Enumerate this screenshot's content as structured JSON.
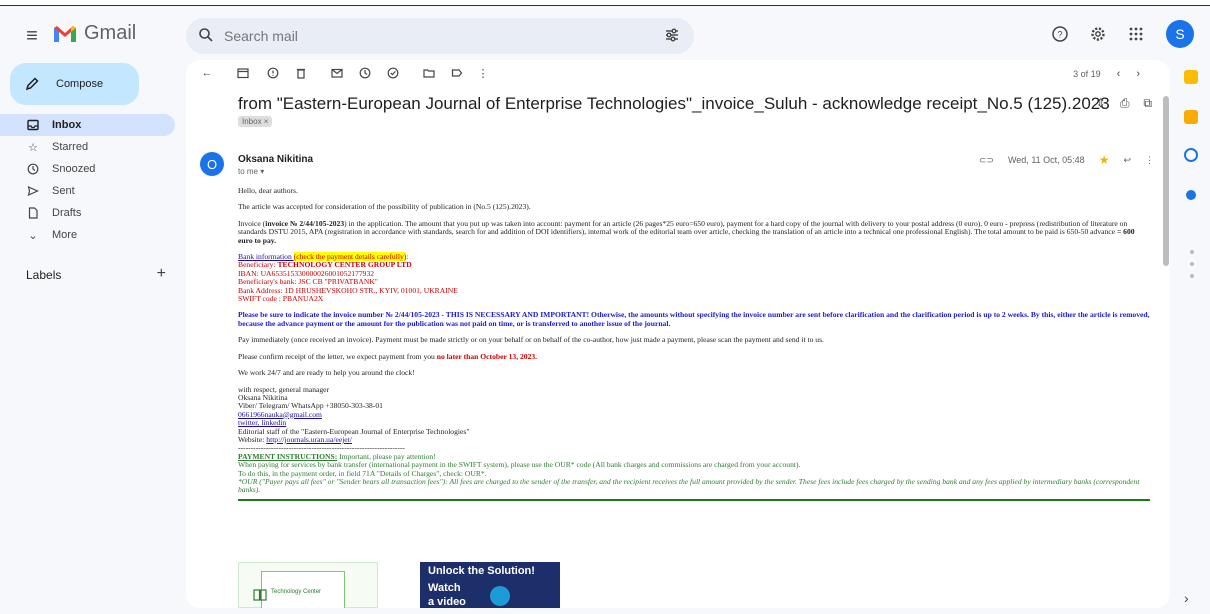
{
  "app": {
    "name": "Gmail"
  },
  "search": {
    "placeholder": "Search mail"
  },
  "header_icons": [
    "help-icon",
    "settings-icon",
    "apps-icon"
  ],
  "account_initial": "S",
  "sidebar": {
    "compose_label": "Compose",
    "items": [
      {
        "label": "Inbox",
        "icon": "inbox-icon",
        "active": true
      },
      {
        "label": "Starred",
        "icon": "star-icon"
      },
      {
        "label": "Snoozed",
        "icon": "clock-icon"
      },
      {
        "label": "Sent",
        "icon": "send-icon"
      },
      {
        "label": "Drafts",
        "icon": "draft-icon"
      },
      {
        "label": "More",
        "icon": "chevron-down-icon"
      }
    ],
    "labels_title": "Labels",
    "labels_add": "+"
  },
  "toolbar": {
    "pager": "3 of 19"
  },
  "email": {
    "subject": "from \"Eastern-European Journal of Enterprise Technologies\"_invoice_Suluh - acknowledge receipt_No.5 (125).2023",
    "chip": "Inbox ×",
    "sender_initial": "O",
    "sender": "Oksana Nikitina",
    "to": "to me ▾",
    "date": "Wed, 11 Oct, 05:48",
    "greeting": "Hello, dear authors.",
    "accepted": "The article was accepted for consideration of the possibility of publication in (No.5 (125).2023).",
    "invoice_pre": "Invoice (",
    "invoice_bold": "invoice № 2/44/105-2023",
    "invoice_text": ")  in the application. The amount that you put up was taken into account: payment for an article (26 pages*25 euro=650 euro), payment for a hard copy of the   journal with delivery to your postal address (0 euro), 0 euro - prepress (redistribution of literature on standards DSTU 2015, APA (registration in accordance with standards, search for and addition of  DOI identifiers), internal work of the editorial team over article, checking the translation of an article into a technical one professional English). The total amount to be paid is 650-50 advance ",
    "invoice_total": "= 600 euro to pay.",
    "bank_info": "Bank information ",
    "bank_check": "(check the payment details carefully)",
    "bank_colon": ":",
    "beneficiary_label": "Beneficiary: ",
    "beneficiary": "TECHNOLOGY CENTER GROUP LTD",
    "iban": "IBAN: UA653515330000026001052177932",
    "bank": "Beneficiary's bank: JSC CB \"PRIVATBANK\"",
    "bank_address": "Bank Address: 1D HRUSHEVSKOHO STR., KYIV, 01001, UKRAINE",
    "swift": "SWIFT code : PBANUA2X",
    "important": "Please be sure to indicate the invoice number  № 2/44/105-2023 - THIS IS NECESSARY AND IMPORTANT! Otherwise, the amounts without specifying the invoice number are sent before clarification and the clarification period is up to 2 weeks. By this, either the article is removed, because the advance payment or the amount for the publication was not paid on time, or is transferred to another issue of the journal.",
    "pay_immediately": "Pay immediately (once received an invoice). Payment must be made strictly or on your behalf or on behalf of the co-author, how just made a payment, please scan the payment and send it to us.",
    "confirm_pre": "Please confirm receipt of the letter, we expect payment from you ",
    "confirm_deadline": "no later than October 13, 2023.",
    "work": "We work 24/7 and are ready to help you around the clock!",
    "sig1": "with respect, general manager",
    "sig2": "Oksana Nikitina",
    "sig3": "Viber/ Telegram/ WhatsApp  +38050-303-38-01",
    "sig_email": "0661966nauka@gmail.com",
    "sig_social": "twitter, linkedin",
    "sig4": "Editorial staff of the \"Eastern-European  Journal of Enterprise Technologies\"",
    "website_label": "Website: ",
    "website": "http://journals.uran.ua/eejet/",
    "dashes": "------------------------------------------------------------------",
    "pi_title": "PAYMENT INSTRUCTIONS:",
    "pi_text": "  Important, please pay attention!",
    "pi_line1": "When paying for services by bank transfer (international payment in the SWIFT system), please use the OUR* code (All bank charges and commissions are charged from your account).",
    "pi_line2": "To do this, in the payment order, in field 71A \"Details of Charges\", check: OUR*.",
    "pi_line3": "*OUR (\"Payer pays all fees\" or \"Sender bears all transaction fees\"): All fees are charged to the sender of the transfer, and the recipient receives the full amount provided by the sender. These fees include fees charged by the sending bank and any fees applied by intermediary banks (correspondent banks)."
  },
  "ads": {
    "tc_label": "Technology Center",
    "unlock": "Unlock the Solution!",
    "watch": "Watch",
    "video": "a video"
  }
}
